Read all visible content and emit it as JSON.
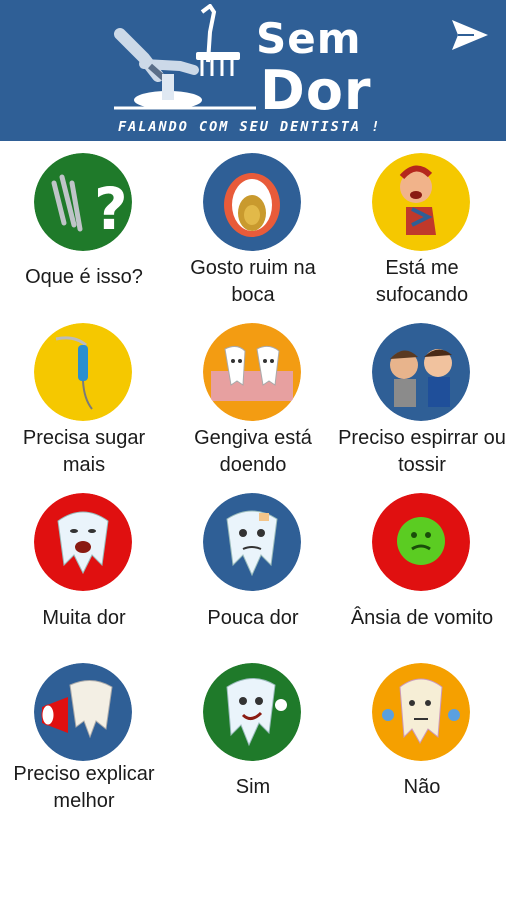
{
  "app": {
    "title_line1": "Sem",
    "title_line2": "Dor",
    "tagline": "FALANDO COM SEU DENTISTA !",
    "header_color": "#2f5f96",
    "send_icon": "send-arrow-icon"
  },
  "cards": [
    {
      "label": "Oque é isso?",
      "icon": "dental-tools-question-icon",
      "bg": "#1f7a2a"
    },
    {
      "label": "Gosto ruim na boca",
      "icon": "mouth-tongue-icon",
      "bg": "#2f5f96"
    },
    {
      "label": "Está me sufocando",
      "icon": "choking-person-icon",
      "bg": "#f5c800"
    },
    {
      "label": "Precisa sugar mais",
      "icon": "suction-tool-icon",
      "bg": "#f5c800"
    },
    {
      "label": "Gengiva está doendo",
      "icon": "teeth-gum-icon",
      "bg": "#f39c12"
    },
    {
      "label": "Preciso espirrar ou tossir",
      "icon": "sneezing-people-icon",
      "bg": "#2f5f96"
    },
    {
      "label": "Muita dor",
      "icon": "crying-tooth-icon",
      "bg": "#e01010"
    },
    {
      "label": "Pouca dor",
      "icon": "worried-tooth-icon",
      "bg": "#2f5f96"
    },
    {
      "label": "Ânsia de vomito",
      "icon": "nauseous-face-icon",
      "bg": "#e01010"
    },
    {
      "label": "Preciso explicar melhor",
      "icon": "megaphone-tooth-icon",
      "bg": "#2f5f96"
    },
    {
      "label": "Sim",
      "icon": "thumbs-up-tooth-icon",
      "bg": "#1f7a2a"
    },
    {
      "label": "Não",
      "icon": "shrug-tooth-icon",
      "bg": "#f5a000"
    }
  ]
}
